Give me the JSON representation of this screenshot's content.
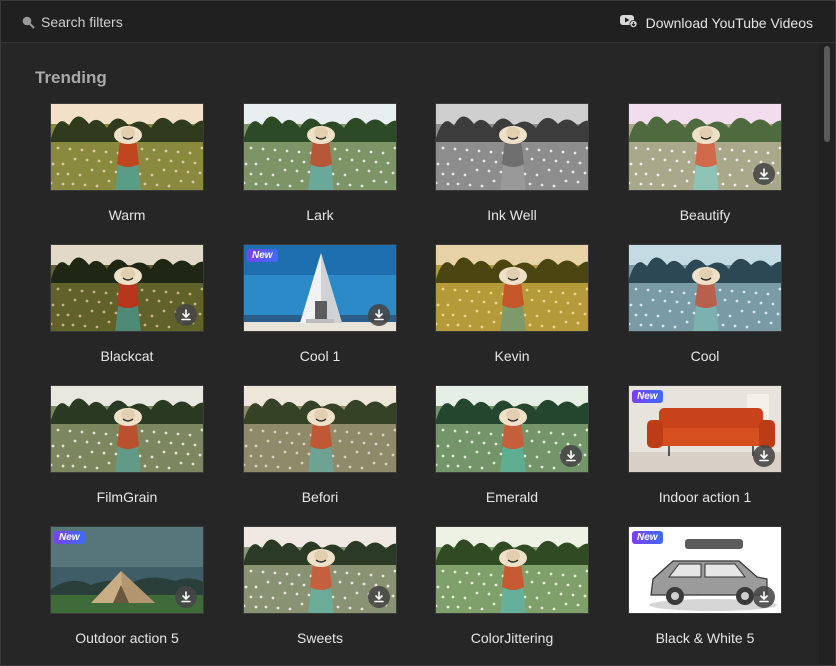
{
  "search": {
    "placeholder": "Search filters",
    "icon": "search-icon"
  },
  "header": {
    "download_label": "Download YouTube Videos",
    "download_icon": "youtube-download-icon"
  },
  "section": {
    "title": "Trending"
  },
  "colors": {
    "background": "#262626",
    "topbar": "#202020",
    "accent_new_start": "#7b3ff2",
    "accent_new_end": "#3d6cf5"
  },
  "filters": [
    {
      "name": "Warm",
      "scene": "field",
      "tone": "warm",
      "download": false,
      "new": false
    },
    {
      "name": "Lark",
      "scene": "field",
      "tone": "lark",
      "download": false,
      "new": false
    },
    {
      "name": "Ink Well",
      "scene": "field",
      "tone": "mono",
      "download": false,
      "new": false
    },
    {
      "name": "Beautify",
      "scene": "field",
      "tone": "beautify",
      "download": true,
      "new": false
    },
    {
      "name": "Blackcat",
      "scene": "field",
      "tone": "dark",
      "download": true,
      "new": false
    },
    {
      "name": "Cool 1",
      "scene": "house",
      "tone": "sky",
      "download": true,
      "new": true,
      "new_label": "New"
    },
    {
      "name": "Kevin",
      "scene": "field",
      "tone": "golden",
      "download": false,
      "new": false
    },
    {
      "name": "Cool",
      "scene": "field",
      "tone": "cool",
      "download": false,
      "new": false
    },
    {
      "name": "FilmGrain",
      "scene": "field",
      "tone": "grain",
      "download": false,
      "new": false
    },
    {
      "name": "Befori",
      "scene": "field",
      "tone": "befori",
      "download": false,
      "new": false
    },
    {
      "name": "Emerald",
      "scene": "field",
      "tone": "emerald",
      "download": true,
      "new": false
    },
    {
      "name": "Indoor action 1",
      "scene": "sofa",
      "tone": "room",
      "download": true,
      "new": true,
      "new_label": "New"
    },
    {
      "name": "Outdoor action 5",
      "scene": "tent",
      "tone": "dusk",
      "download": true,
      "new": true,
      "new_label": "New"
    },
    {
      "name": "Sweets",
      "scene": "field",
      "tone": "sweets",
      "download": true,
      "new": false
    },
    {
      "name": "ColorJittering",
      "scene": "field",
      "tone": "jitter",
      "download": false,
      "new": false
    },
    {
      "name": "Black & White 5",
      "scene": "car",
      "tone": "sketch",
      "download": true,
      "new": true,
      "new_label": "New"
    }
  ]
}
